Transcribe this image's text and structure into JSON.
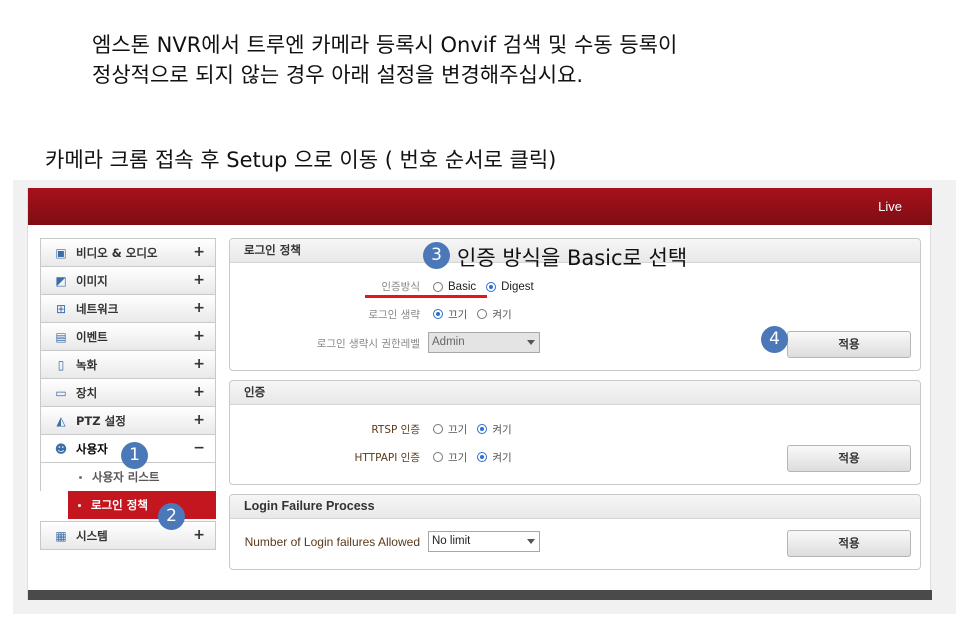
{
  "intro": {
    "line1": "엠스톤 NVR에서 트루엔 카메라 등록시 Onvif 검색 및 수동 등록이",
    "line2": "정상적으로 되지 않는 경우 아래 설정을 변경해주십시요."
  },
  "caption": "카메라 크롬 접속 후 Setup 으로 이동  ( 번호 순서로 클릭)",
  "topbar": {
    "live_label": "Live",
    "color": "#9a0f18"
  },
  "sidebar": {
    "items": [
      {
        "label": "비디오 & 오디오",
        "toggle": "+",
        "icon": "video-audio-icon"
      },
      {
        "label": "이미지",
        "toggle": "+",
        "icon": "image-icon"
      },
      {
        "label": "네트워크",
        "toggle": "+",
        "icon": "network-icon"
      },
      {
        "label": "이벤트",
        "toggle": "+",
        "icon": "event-icon"
      },
      {
        "label": "녹화",
        "toggle": "+",
        "icon": "record-icon"
      },
      {
        "label": "장치",
        "toggle": "+",
        "icon": "device-icon"
      },
      {
        "label": "PTZ 설정",
        "toggle": "+",
        "icon": "ptz-icon"
      },
      {
        "label": "사용자",
        "toggle": "−",
        "icon": "user-icon"
      },
      {
        "label": "시스템",
        "toggle": "+",
        "icon": "system-icon"
      }
    ],
    "subitems": [
      {
        "label": "사용자 리스트"
      },
      {
        "label": "로그인 정책",
        "active": true
      }
    ],
    "active_color": "#c3161f"
  },
  "login_policy": {
    "title": "로그인 정책",
    "auth_method_label": "인증방식",
    "auth_options": [
      "Basic",
      "Digest"
    ],
    "auth_selected": "Digest",
    "skip_login_label": "로그인 생략",
    "skip_options": [
      "끄기",
      "켜기"
    ],
    "skip_selected": "끄기",
    "skip_level_label": "로그인 생략시 권한레벨",
    "skip_level_value": "Admin",
    "apply_label": "적용"
  },
  "auth": {
    "title": "인증",
    "rtsp_label": "RTSP 인증",
    "rtsp_options": [
      "끄기",
      "켜기"
    ],
    "rtsp_selected": "켜기",
    "http_label": "HTTPAPI 인증",
    "http_options": [
      "끄기",
      "켜기"
    ],
    "http_selected": "켜기",
    "apply_label": "적용"
  },
  "login_failure": {
    "title": "Login Failure Process",
    "count_label": "Number of Login failures Allowed",
    "count_value": "No limit",
    "apply_label": "적용"
  },
  "annotations": {
    "step1": "1",
    "step2": "2",
    "step3": "3",
    "step3_text": "인증 방식을 Basic로 선택",
    "step4": "4",
    "marker_color": "#4a78b8",
    "underline_color": "#e8141b"
  }
}
